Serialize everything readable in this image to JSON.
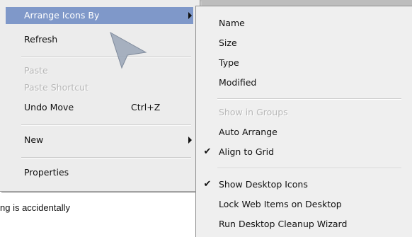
{
  "context_menu": {
    "items": [
      {
        "label": "Arrange Icons By",
        "shortcut": "",
        "submenu": true,
        "state": "selected"
      },
      {
        "label": "Refresh",
        "shortcut": "",
        "submenu": false,
        "state": "normal"
      },
      {
        "label": "Paste",
        "shortcut": "",
        "submenu": false,
        "state": "disabled"
      },
      {
        "label": "Paste Shortcut",
        "shortcut": "",
        "submenu": false,
        "state": "disabled"
      },
      {
        "label": "Undo Move",
        "shortcut": "Ctrl+Z",
        "submenu": false,
        "state": "normal"
      },
      {
        "label": "New",
        "shortcut": "",
        "submenu": true,
        "state": "normal"
      },
      {
        "label": "Properties",
        "shortcut": "",
        "submenu": false,
        "state": "normal"
      }
    ]
  },
  "submenu": {
    "items": [
      {
        "label": "Name",
        "checked": false,
        "state": "normal"
      },
      {
        "label": "Size",
        "checked": false,
        "state": "normal"
      },
      {
        "label": "Type",
        "checked": false,
        "state": "normal"
      },
      {
        "label": "Modified",
        "checked": false,
        "state": "normal"
      },
      {
        "label": "Show in Groups",
        "checked": false,
        "state": "disabled"
      },
      {
        "label": "Auto Arrange",
        "checked": false,
        "state": "normal"
      },
      {
        "label": "Align to Grid",
        "checked": true,
        "state": "normal"
      },
      {
        "label": "Show Desktop Icons",
        "checked": true,
        "state": "normal"
      },
      {
        "label": "Lock Web Items on Desktop",
        "checked": false,
        "state": "normal"
      },
      {
        "label": "Run Desktop Cleanup Wizard",
        "checked": false,
        "state": "normal"
      }
    ],
    "check_glyph": "✔"
  },
  "background_text": "ng is accidentally",
  "colors": {
    "selection": "#7f98c9",
    "menu_bg": "#ececec",
    "disabled_text": "#b7b7b7"
  }
}
